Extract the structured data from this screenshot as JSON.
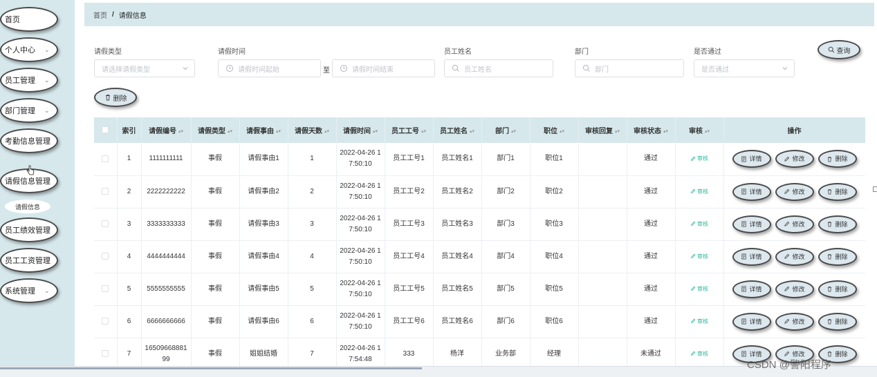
{
  "sidebar": {
    "items": [
      {
        "label": "首页",
        "has_arrow": false
      },
      {
        "label": "个人中心",
        "has_arrow": true
      },
      {
        "label": "员工管理",
        "has_arrow": true
      },
      {
        "label": "部门管理",
        "has_arrow": true
      },
      {
        "label": "考勤信息管理",
        "has_arrow": true
      },
      {
        "label": "请假信息管理",
        "has_arrow": true
      },
      {
        "label": "员工绩效管理",
        "has_arrow": true
      },
      {
        "label": "员工工资管理",
        "has_arrow": true
      },
      {
        "label": "系统管理",
        "has_arrow": true
      }
    ],
    "sub_item": "请假信息"
  },
  "breadcrumb": {
    "home": "首页",
    "sep": "/",
    "current": "请假信息"
  },
  "search": {
    "type_label": "请假类型",
    "type_placeholder": "请选择请假类型",
    "time_label": "请假时间",
    "time_start_placeholder": "请假时间起始",
    "time_to": "至",
    "time_end_placeholder": "请假时间结束",
    "name_label": "员工姓名",
    "name_placeholder": "员工姓名",
    "dept_label": "部门",
    "dept_placeholder": "部门",
    "pass_label": "是否通过",
    "pass_placeholder": "是否通过",
    "query_button": "查询"
  },
  "toolbar": {
    "delete_button": "删除"
  },
  "table": {
    "headers": [
      "",
      "索引",
      "请假编号",
      "请假类型",
      "请假事由",
      "请假天数",
      "请假时间",
      "员工工号",
      "员工姓名",
      "部门",
      "职位",
      "审核回复",
      "审核状态",
      "审核",
      "操作"
    ],
    "sortable": [
      false,
      false,
      true,
      true,
      true,
      true,
      true,
      true,
      true,
      true,
      true,
      true,
      true,
      true,
      false
    ],
    "audit_label": "审核",
    "actions": {
      "detail": "详情",
      "edit": "修改",
      "delete": "删除"
    },
    "rows": [
      {
        "index": "1",
        "code": "1111111111",
        "type": "事假",
        "reason": "请假事由1",
        "days": "1",
        "time": "2022-04-26 17:50:10",
        "emp_no": "员工工号1",
        "emp_name": "员工姓名1",
        "dept": "部门1",
        "position": "职位1",
        "reply": "",
        "status": "通过"
      },
      {
        "index": "2",
        "code": "2222222222",
        "type": "事假",
        "reason": "请假事由2",
        "days": "2",
        "time": "2022-04-26 17:50:10",
        "emp_no": "员工工号2",
        "emp_name": "员工姓名2",
        "dept": "部门2",
        "position": "职位2",
        "reply": "",
        "status": "通过"
      },
      {
        "index": "3",
        "code": "3333333333",
        "type": "事假",
        "reason": "请假事由3",
        "days": "3",
        "time": "2022-04-26 17:50:10",
        "emp_no": "员工工号3",
        "emp_name": "员工姓名3",
        "dept": "部门3",
        "position": "职位3",
        "reply": "",
        "status": "通过"
      },
      {
        "index": "4",
        "code": "4444444444",
        "type": "事假",
        "reason": "请假事由4",
        "days": "4",
        "time": "2022-04-26 17:50:10",
        "emp_no": "员工工号4",
        "emp_name": "员工姓名4",
        "dept": "部门4",
        "position": "职位4",
        "reply": "",
        "status": "通过"
      },
      {
        "index": "5",
        "code": "5555555555",
        "type": "事假",
        "reason": "请假事由5",
        "days": "5",
        "time": "2022-04-26 17:50:10",
        "emp_no": "员工工号5",
        "emp_name": "员工姓名5",
        "dept": "部门5",
        "position": "职位5",
        "reply": "",
        "status": "通过"
      },
      {
        "index": "6",
        "code": "6666666666",
        "type": "事假",
        "reason": "请假事由6",
        "days": "6",
        "time": "2022-04-26 17:50:10",
        "emp_no": "员工工号6",
        "emp_name": "员工姓名6",
        "dept": "部门6",
        "position": "职位6",
        "reply": "",
        "status": "通过"
      },
      {
        "index": "7",
        "code": "1650966888199",
        "type": "事假",
        "reason": "姐姐结婚",
        "days": "7",
        "time": "2022-04-26 17:54:48",
        "emp_no": "333",
        "emp_name": "杨洋",
        "dept": "业务部",
        "position": "经理",
        "reply": "",
        "status": "未通过"
      }
    ]
  },
  "watermark": "CSDN @警阳程序",
  "colors": {
    "sidebar_bg": "#d6e8ec",
    "header_bg": "#d6e8ec",
    "button_bg": "#dce8ee",
    "audit_green": "#2ab89a"
  }
}
